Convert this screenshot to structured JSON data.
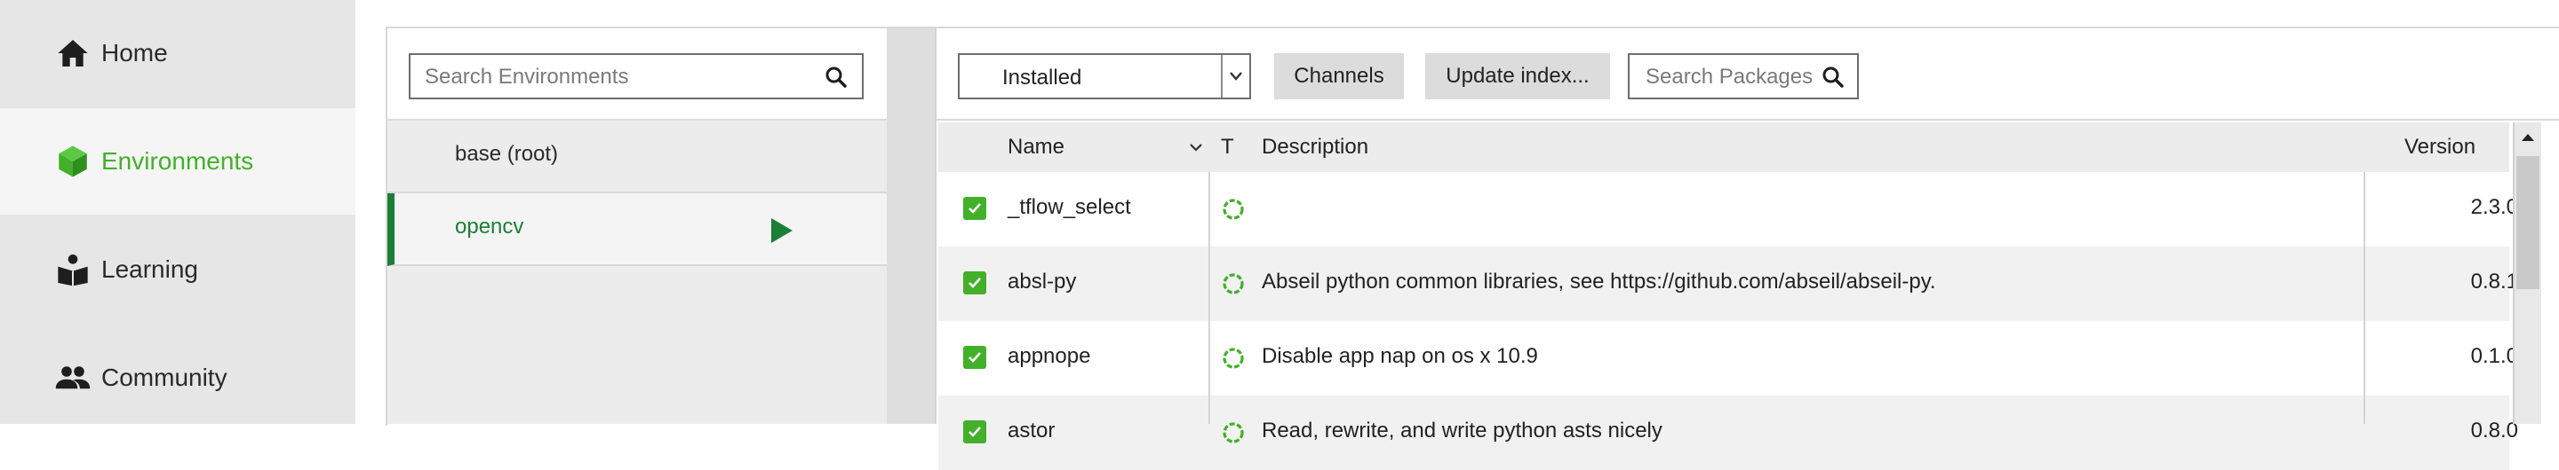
{
  "sidebar": {
    "items": [
      {
        "label": "Home",
        "icon": "home-icon"
      },
      {
        "label": "Environments",
        "icon": "cube-icon",
        "active": true
      },
      {
        "label": "Learning",
        "icon": "book-reader-icon"
      },
      {
        "label": "Community",
        "icon": "people-icon"
      }
    ]
  },
  "environments": {
    "search_placeholder": "Search Environments",
    "items": [
      {
        "name": "base (root)"
      },
      {
        "name": "opencv",
        "active": true
      }
    ]
  },
  "packages": {
    "filter_value": "Installed",
    "channels_label": "Channels",
    "update_index_label": "Update index...",
    "search_placeholder": "Search Packages",
    "columns": {
      "name": "Name",
      "type": "T",
      "description": "Description",
      "version": "Version"
    },
    "rows": [
      {
        "name": "_tflow_select",
        "description": "",
        "version": "2.3.0",
        "checked": true
      },
      {
        "name": "absl-py",
        "description": "Abseil python common libraries, see https://github.com/abseil/abseil-py.",
        "version": "0.8.1",
        "checked": true
      },
      {
        "name": "appnope",
        "description": "Disable app nap on os x 10.9",
        "version": "0.1.0",
        "checked": true
      },
      {
        "name": "astor",
        "description": "Read, rewrite, and write python asts nicely",
        "version": "0.8.0",
        "checked": true
      }
    ]
  },
  "colors": {
    "accent_green": "#43b02a",
    "active_env_green": "#1a7f37",
    "sidebar_bg": "#e6e6e6"
  }
}
